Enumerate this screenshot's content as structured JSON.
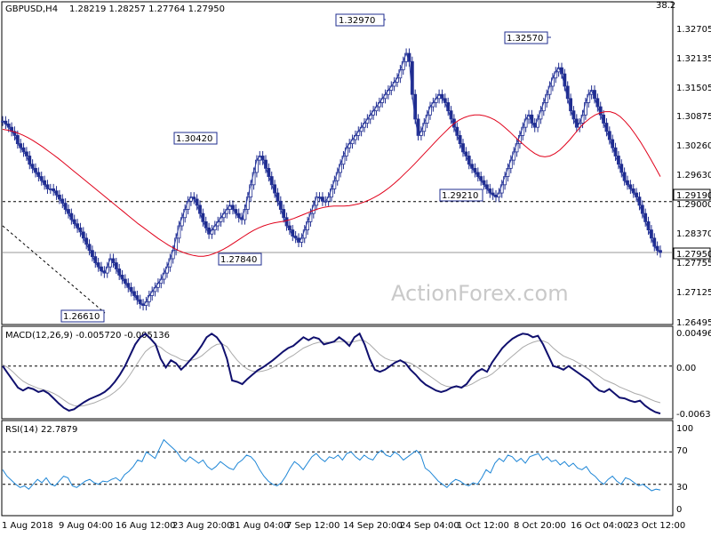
{
  "chart_data": [
    {
      "type": "candlestick-line",
      "title": "GBPUSD,H4",
      "ohlc_header": "1.28219 1.28257 1.27764 1.27950",
      "top_right_label": "38.2",
      "ylim": [
        1.2624,
        1.3345
      ],
      "y_ticks": [
        "1.32705",
        "1.32135",
        "1.31505",
        "1.30875",
        "1.30260",
        "1.29630",
        "1.29000",
        "1.28370",
        "1.27755",
        "1.27125",
        "1.26495"
      ],
      "x_ticks": [
        "1 Aug 2018",
        "9 Aug 04:00",
        "16 Aug 12:00",
        "23 Aug 20:00",
        "31 Aug 04:00",
        "7 Sep 12:00",
        "14 Sep 20:00",
        "24 Sep 04:00",
        "1 Oct 12:00",
        "8 Oct 20:00",
        "16 Oct 04:00",
        "23 Oct 12:00"
      ],
      "close_series": [
        1.3115,
        1.3108,
        1.31,
        1.309,
        1.308,
        1.306,
        1.305,
        1.304,
        1.303,
        1.301,
        1.3,
        1.299,
        1.298,
        1.297,
        1.296,
        1.295,
        1.295,
        1.2945,
        1.2935,
        1.2925,
        1.2915,
        1.29,
        1.289,
        1.2875,
        1.2865,
        1.2855,
        1.2845,
        1.283,
        1.2815,
        1.28,
        1.2785,
        1.277,
        1.276,
        1.275,
        1.2745,
        1.276,
        1.278,
        1.277,
        1.2755,
        1.274,
        1.273,
        1.272,
        1.271,
        1.27,
        1.269,
        1.268,
        1.267,
        1.2666,
        1.2675,
        1.269,
        1.27,
        1.271,
        1.272,
        1.273,
        1.2745,
        1.276,
        1.278,
        1.28,
        1.283,
        1.286,
        1.288,
        1.29,
        1.292,
        1.293,
        1.2925,
        1.291,
        1.289,
        1.287,
        1.2855,
        1.284,
        1.285,
        1.286,
        1.287,
        1.288,
        1.289,
        1.29,
        1.291,
        1.29,
        1.289,
        1.288,
        1.2875,
        1.29,
        1.293,
        1.296,
        1.299,
        1.302,
        1.303,
        1.302,
        1.3,
        1.298,
        1.296,
        1.294,
        1.292,
        1.29,
        1.288,
        1.286,
        1.285,
        1.2835,
        1.283,
        1.282,
        1.283,
        1.285,
        1.287,
        1.289,
        1.291,
        1.293,
        1.293,
        1.292,
        1.292,
        1.293,
        1.295,
        1.297,
        1.299,
        1.301,
        1.303,
        1.305,
        1.306,
        1.307,
        1.308,
        1.309,
        1.31,
        1.311,
        1.312,
        1.313,
        1.314,
        1.315,
        1.316,
        1.317,
        1.318,
        1.319,
        1.32,
        1.321,
        1.322,
        1.324,
        1.326,
        1.328,
        1.326,
        1.318,
        1.312,
        1.308,
        1.309,
        1.311,
        1.313,
        1.315,
        1.316,
        1.317,
        1.318,
        1.317,
        1.316,
        1.314,
        1.312,
        1.31,
        1.308,
        1.306,
        1.304,
        1.303,
        1.301,
        1.3,
        1.299,
        1.298,
        1.297,
        1.296,
        1.295,
        1.294,
        1.2935,
        1.293,
        1.294,
        1.296,
        1.298,
        1.3,
        1.302,
        1.304,
        1.306,
        1.308,
        1.31,
        1.312,
        1.313,
        1.311,
        1.31,
        1.312,
        1.314,
        1.316,
        1.318,
        1.32,
        1.322,
        1.3235,
        1.3245,
        1.323,
        1.32,
        1.317,
        1.314,
        1.312,
        1.31,
        1.311,
        1.313,
        1.316,
        1.318,
        1.319,
        1.317,
        1.315,
        1.313,
        1.311,
        1.309,
        1.307,
        1.305,
        1.303,
        1.301,
        1.299,
        1.297,
        1.296,
        1.295,
        1.294,
        1.293,
        1.291,
        1.289,
        1.287,
        1.285,
        1.283,
        1.281,
        1.28,
        1.2795
      ],
      "moving_average": [
        1.3095,
        1.3093,
        1.309,
        1.3086,
        1.3081,
        1.3075,
        1.3068,
        1.306,
        1.3052,
        1.3043,
        1.3034,
        1.3025,
        1.3015,
        1.3005,
        1.2995,
        1.2985,
        1.2975,
        1.2965,
        1.2955,
        1.2945,
        1.2935,
        1.2925,
        1.2915,
        1.2905,
        1.2895,
        1.2885,
        1.2875,
        1.2865,
        1.2856,
        1.2847,
        1.2838,
        1.2829,
        1.2821,
        1.2813,
        1.2806,
        1.28,
        1.2795,
        1.2791,
        1.2788,
        1.2786,
        1.2786,
        1.2788,
        1.2792,
        1.2797,
        1.2803,
        1.281,
        1.2818,
        1.2826,
        1.2834,
        1.2842,
        1.2849,
        1.2855,
        1.286,
        1.2864,
        1.2867,
        1.2869,
        1.2871,
        1.2874,
        1.2878,
        1.2883,
        1.2888,
        1.2893,
        1.2898,
        1.2902,
        1.2905,
        1.2907,
        1.2908,
        1.2908,
        1.2908,
        1.2909,
        1.2911,
        1.2914,
        1.2918,
        1.2923,
        1.2929,
        1.2936,
        1.2944,
        1.2953,
        1.2963,
        1.2974,
        1.2986,
        1.2998,
        1.301,
        1.3023,
        1.3036,
        1.3049,
        1.3062,
        1.3075,
        1.3087,
        1.3099,
        1.311,
        1.3118,
        1.3124,
        1.3128,
        1.313,
        1.313,
        1.3128,
        1.3124,
        1.3118,
        1.311,
        1.31,
        1.3089,
        1.3077,
        1.3066,
        1.3055,
        1.3045,
        1.3036,
        1.303,
        1.3028,
        1.303,
        1.3036,
        1.3045,
        1.3057,
        1.307,
        1.3085,
        1.31,
        1.3112,
        1.3122,
        1.313,
        1.3135,
        1.3138,
        1.3138,
        1.3134,
        1.3126,
        1.3114,
        1.31,
        1.3083,
        1.3065,
        1.3045,
        1.3024,
        1.3002,
        1.298
      ],
      "annotations": [
        "1.32970",
        "1.30420",
        "1.27840",
        "1.26610",
        "1.29210",
        "1.32570"
      ],
      "price_tags": [
        "1.29190",
        "1.27950"
      ],
      "watermark": "ActionForex.com"
    },
    {
      "type": "line",
      "title": "MACD(12,26,9) -0.005720 -0.005136",
      "ylim": [
        -0.0072,
        0.0054
      ],
      "y_ticks": [
        "0.004968",
        "0.00",
        "-0.006372"
      ],
      "series": [
        {
          "values": [
            0.0,
            -0.001,
            -0.002,
            -0.003,
            -0.0034,
            -0.003,
            -0.0032,
            -0.0036,
            -0.0034,
            -0.0038,
            -0.0045,
            -0.0052,
            -0.0058,
            -0.0062,
            -0.006,
            -0.0055,
            -0.005,
            -0.0046,
            -0.0043,
            -0.004,
            -0.0036,
            -0.003,
            -0.0022,
            -0.0012,
            0.0,
            0.0015,
            0.003,
            0.004,
            0.0045,
            0.0038,
            0.003,
            0.001,
            -0.0002,
            0.0008,
            0.0004,
            -0.0005,
            0.0002,
            0.001,
            0.0018,
            0.0028,
            0.004,
            0.0045,
            0.004,
            0.003,
            0.001,
            -0.002,
            -0.0022,
            -0.0025,
            -0.0018,
            -0.0012,
            -0.0006,
            -0.0002,
            0.0003,
            0.0008,
            0.0014,
            0.002,
            0.0025,
            0.0028,
            0.0034,
            0.004,
            0.0036,
            0.004,
            0.0038,
            0.003,
            0.0032,
            0.0034,
            0.004,
            0.0035,
            0.0028,
            0.004,
            0.0045,
            0.003,
            0.001,
            -0.0005,
            -0.0008,
            -0.0005,
            0.0,
            0.0005,
            0.0008,
            0.0004,
            -0.0005,
            -0.0012,
            -0.002,
            -0.0026,
            -0.003,
            -0.0034,
            -0.0036,
            -0.0034,
            -0.003,
            -0.0028,
            -0.003,
            -0.0025,
            -0.0015,
            -0.0008,
            -0.0004,
            -0.0008,
            0.0005,
            0.0015,
            0.0025,
            0.0032,
            0.0038,
            0.0042,
            0.0045,
            0.0044,
            0.004,
            0.0042,
            0.003,
            0.0015,
            0.0,
            -0.0002,
            -0.0005,
            0.0,
            -0.0005,
            -0.001,
            -0.0015,
            -0.002,
            -0.0028,
            -0.0034,
            -0.0036,
            -0.0032,
            -0.0038,
            -0.0044,
            -0.0045,
            -0.0048,
            -0.005,
            -0.0048,
            -0.0055,
            -0.006,
            -0.0064,
            -0.0066
          ]
        },
        {
          "values": [
            0.0002,
            -0.0002,
            -0.0008,
            -0.0015,
            -0.0021,
            -0.0025,
            -0.0028,
            -0.0031,
            -0.0033,
            -0.0035,
            -0.0038,
            -0.0042,
            -0.0047,
            -0.0052,
            -0.0055,
            -0.0056,
            -0.0055,
            -0.0053,
            -0.0051,
            -0.0048,
            -0.0045,
            -0.0041,
            -0.0036,
            -0.003,
            -0.0022,
            -0.0012,
            -0.0001,
            0.001,
            0.002,
            0.0026,
            0.0029,
            0.0026,
            0.002,
            0.0016,
            0.0013,
            0.0009,
            0.0007,
            0.0008,
            0.001,
            0.0014,
            0.002,
            0.0026,
            0.003,
            0.0031,
            0.0027,
            0.0017,
            0.0008,
            0.0001,
            -0.0004,
            -0.0007,
            -0.0008,
            -0.0007,
            -0.0005,
            -0.0002,
            0.0002,
            0.0006,
            0.0011,
            0.0015,
            0.002,
            0.0025,
            0.0028,
            0.0031,
            0.0033,
            0.0033,
            0.0033,
            0.0033,
            0.0034,
            0.0034,
            0.0033,
            0.0034,
            0.0036,
            0.0035,
            0.003,
            0.0023,
            0.0016,
            0.0011,
            0.0008,
            0.0007,
            0.0007,
            0.0006,
            0.0004,
            0.0,
            -0.0005,
            -0.001,
            -0.0015,
            -0.002,
            -0.0025,
            -0.0028,
            -0.0029,
            -0.0029,
            -0.0029,
            -0.0028,
            -0.0025,
            -0.0021,
            -0.0017,
            -0.0015,
            -0.0011,
            -0.0005,
            0.0001,
            0.0008,
            0.0014,
            0.002,
            0.0026,
            0.003,
            0.0033,
            0.0035,
            0.0035,
            0.0032,
            0.0025,
            0.0019,
            0.0014,
            0.0011,
            0.0008,
            0.0004,
            0.0,
            -0.0004,
            -0.0009,
            -0.0014,
            -0.0019,
            -0.0022,
            -0.0025,
            -0.0029,
            -0.0032,
            -0.0035,
            -0.0038,
            -0.004,
            -0.0043,
            -0.0046,
            -0.0049,
            -0.0051
          ]
        }
      ],
      "zero_line": 0
    },
    {
      "type": "line",
      "title": "RSI(14) 22.7879",
      "ylim": [
        0,
        100
      ],
      "y_ticks": [
        "100",
        "70",
        "30",
        "0"
      ],
      "levels": [
        70,
        30
      ],
      "series": [
        {
          "values": [
            48,
            40,
            35,
            30,
            26,
            28,
            24,
            30,
            36,
            32,
            38,
            30,
            28,
            34,
            40,
            38,
            28,
            26,
            30,
            34,
            36,
            32,
            30,
            34,
            33,
            36,
            38,
            34,
            42,
            46,
            52,
            60,
            58,
            70,
            66,
            62,
            74,
            85,
            80,
            75,
            70,
            62,
            58,
            64,
            60,
            56,
            60,
            52,
            48,
            52,
            58,
            54,
            50,
            48,
            56,
            60,
            66,
            64,
            58,
            48,
            40,
            34,
            30,
            28,
            32,
            40,
            50,
            58,
            54,
            48,
            56,
            64,
            68,
            62,
            58,
            64,
            62,
            66,
            60,
            68,
            70,
            64,
            60,
            66,
            62,
            60,
            68,
            72,
            66,
            64,
            70,
            66,
            60,
            64,
            68,
            72,
            66,
            50,
            46,
            40,
            34,
            30,
            26,
            32,
            36,
            34,
            30,
            28,
            32,
            30,
            38,
            48,
            44,
            56,
            62,
            58,
            66,
            64,
            58,
            62,
            56,
            64,
            66,
            68,
            60,
            64,
            58,
            60,
            54,
            58,
            52,
            56,
            50,
            48,
            52,
            44,
            40,
            34,
            30,
            36,
            40,
            34,
            30,
            38,
            36,
            32,
            28,
            30,
            26,
            22,
            24,
            23
          ]
        }
      ]
    }
  ]
}
